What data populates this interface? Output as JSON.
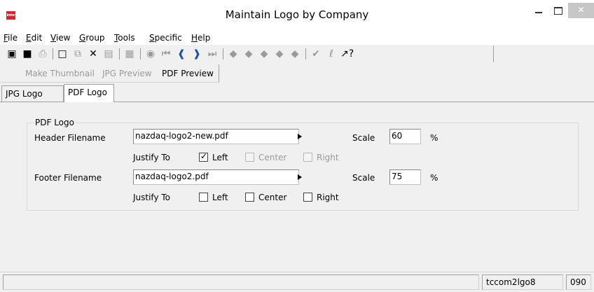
{
  "window": {
    "title": "Maintain Logo by Company",
    "app_logo_text": "infor",
    "close_glyph": "✕"
  },
  "menu": [
    "File",
    "Edit",
    "View",
    "Group",
    "Tools",
    "Specific",
    "Help"
  ],
  "toolbar_icons": [
    "save-and-exit-icon",
    "save-icon",
    "print-icon",
    "new-document-icon",
    "copy-icon",
    "delete-icon",
    "attachment-document-icon",
    "text-icon",
    "find-icon",
    "first-record-icon",
    "previous-record-icon",
    "next-record-icon",
    "last-record-icon",
    "group-icon-1",
    "group-icon-2",
    "group-icon-3",
    "group-icon-4",
    "group-icon-5",
    "check-icon",
    "paperclip-icon",
    "help-pointer-icon"
  ],
  "sub_toolbar": {
    "make_thumbnail": "Make Thumbnail",
    "jpg_preview": "JPG Preview",
    "pdf_preview": "PDF Preview"
  },
  "tabs": [
    {
      "label": "JPG Logo",
      "selected": false
    },
    {
      "label": "PDF Logo",
      "selected": true
    }
  ],
  "form": {
    "group_title": "PDF Logo",
    "header": {
      "label": "Header Filename",
      "value": "nazdaq-logo2-new.pdf",
      "scale_label": "Scale",
      "scale_value": "60",
      "percent": "%",
      "justify_label": "Justify To",
      "left": {
        "label": "Left",
        "checked": true,
        "enabled": true
      },
      "center": {
        "label": "Center",
        "checked": false,
        "enabled": false
      },
      "right": {
        "label": "Right",
        "checked": false,
        "enabled": false
      }
    },
    "footer": {
      "label": "Footer Filename",
      "value": "nazdaq-logo2.pdf",
      "scale_label": "Scale",
      "scale_value": "75",
      "percent": "%",
      "justify_label": "Justify To",
      "left": {
        "label": "Left",
        "checked": false,
        "enabled": true
      },
      "center": {
        "label": "Center",
        "checked": false,
        "enabled": true
      },
      "right": {
        "label": "Right",
        "checked": false,
        "enabled": true
      }
    }
  },
  "status": {
    "session": "tccom2lgo8",
    "company": "090"
  },
  "colors": {
    "close_button_bg": "#c7c7c7",
    "logo_red": "#e41e26",
    "disabled_text": "#9a9a9a"
  }
}
